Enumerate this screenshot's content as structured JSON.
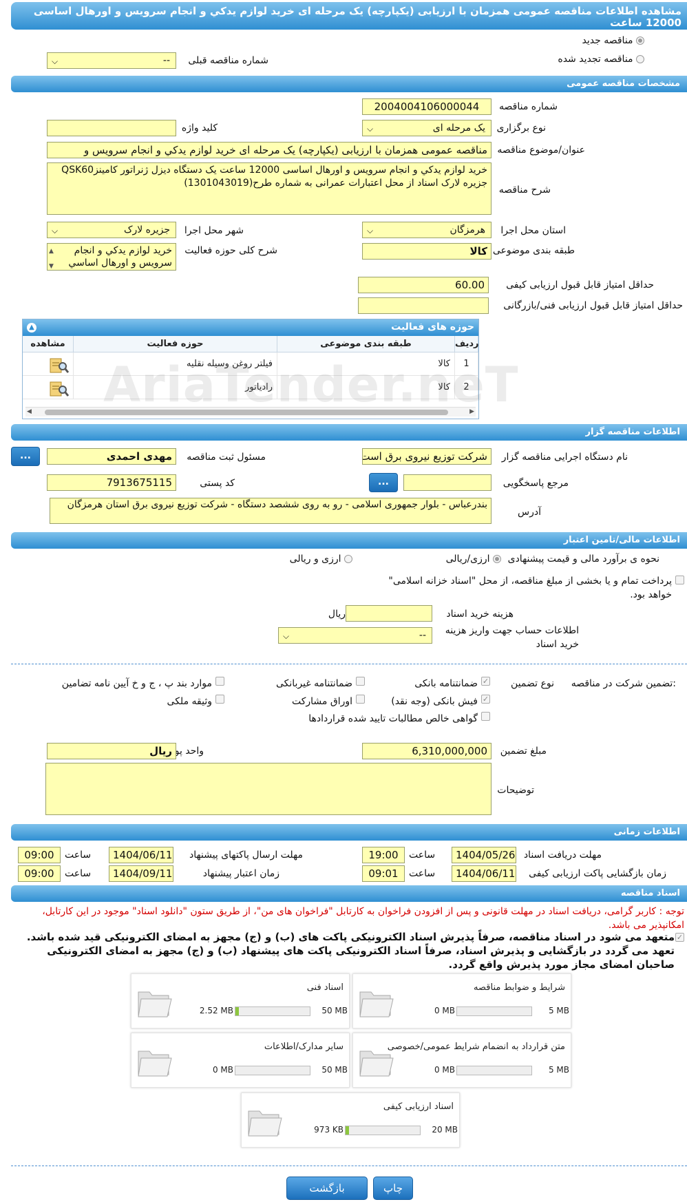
{
  "header": {
    "title": "مشاهده اطلاعات مناقصه عمومی همزمان با ارزیابی (یکپارچه) یک مرحله ای خرید لوازم یدکي و انجام سرویس و اورهال اساسی 12000 ساعت"
  },
  "top": {
    "new_label": "مناقصه جدید",
    "renewed_label": "مناقصه تجدید شده",
    "prev_no_label": "شماره مناقصه قبلی",
    "prev_no_value": "--"
  },
  "general": {
    "section_title": "مشخصات مناقصه عمومی",
    "tender_no_label": "شماره مناقصه",
    "tender_no": "2004004106000044",
    "type_label": "نوع برگزاری",
    "type_value": "یک مرحله ای",
    "keyword_label": "کلید واژه",
    "keyword_value": "",
    "subject_label": "عنوان/موضوع مناقصه",
    "subject_value": "مناقصه عمومی همزمان با ارزیابی (یکپارچه) یک مرحله ای خرید لوازم یدکي و انجام سرویس و",
    "desc_label": "شرح مناقصه",
    "desc_value": "خرید لوازم یدکي و انجام سرویس و اورهال اساسی 12000 ساعت یک دستگاه دیزل ژنراتور کامینزQSK60 جزیره لارک اسناد  از  محل اعتبارات عمرانی به شماره طرح(1301043019)",
    "province_label": "استان محل اجرا",
    "province_value": "هرمزگان",
    "city_label": "شهر محل اجرا",
    "city_value": "جزیره لارک",
    "category_label": "طبقه بندی موضوعی",
    "category_value": "کالا",
    "scope_label": "شرح کلی حوزه فعالیت",
    "scope_value": "خرید لوازم یدکي و انجام سرویس و اورهال اساسي",
    "min_quality_label": "حداقل امتیاز قابل قبول ارزیابی کیفی",
    "min_quality_value": "60.00",
    "min_tech_label": "حداقل امتیاز قابل قبول ارزیابی فنی/بازرگانی",
    "min_tech_value": ""
  },
  "activities": {
    "title": "حوزه های فعالیت",
    "columns": [
      "ردیف",
      "طبقه بندی موضوعی",
      "حوزه فعالیت",
      "مشاهده"
    ],
    "rows": [
      [
        "1",
        "کالا",
        "فیلتر روغن وسیله نقلیه"
      ],
      [
        "2",
        "کالا",
        "رادیاتور"
      ]
    ]
  },
  "watermark": "AriaTender.neT",
  "organizer": {
    "section_title": "اطلاعات مناقصه گزار",
    "org_label": "نام دستگاه اجرایی مناقصه گزار",
    "org_value": "شرکت توزیع نیروی برق است",
    "responsible_label": "مسئول ثبت مناقصه",
    "responsible_value": "مهدی احمدی",
    "ref_label": "مرجع پاسخگویی",
    "ref_value": "",
    "postal_label": "کد پستی",
    "postal_value": "7913675115",
    "address_label": "آدرس",
    "address_value": "بندرعباس - بلوار جمهوری اسلامی - رو به روی ششصد دستگاه - شرکت توزیع نیروی برق استان هرمزگان",
    "dots": "..."
  },
  "financial": {
    "section_title": "اطلاعات مالی/تامین اعتبار",
    "estimate_label": "نحوه ی برآورد مالی و قیمت پیشنهادی",
    "opt_rial": "ارزی/ریالی",
    "opt_fx": "ارزی و ریالی",
    "treasury_text": "پرداخت تمام و یا بخشی از مبلغ مناقصه، از محل \"اسناد خزانه اسلامی\" خواهد بود.",
    "doc_fee_label": "هزینه خرید اسناد",
    "doc_fee_value": "",
    "doc_fee_unit": "ریال",
    "account_label": "اطلاعات حساب جهت واریز هزینه خرید اسناد",
    "account_value": "--"
  },
  "guarantee": {
    "label": "تضمین شرکت در مناقصه:",
    "type_label": "نوع تضمین",
    "bank": "ضمانتنامه بانکی",
    "nonbank": "ضمانتنامه غیربانکی",
    "regulation": "موارد بند پ ، ج و خ آیین نامه تضامین",
    "check": "فیش بانکی (وجه نقد)",
    "bonds": "اوراق مشارکت",
    "property": "وثیقه ملکی",
    "claims": "گواهی خالص مطالبات تایید شده قراردادها",
    "amount_label": "مبلغ تضمین",
    "amount_value": "6,310,000,000",
    "currency_label": "واحد پول",
    "currency_value": "ریال",
    "notes_label": "توضیحات",
    "notes_value": ""
  },
  "timing": {
    "section_title": "اطلاعات زمانی",
    "receive_label": "مهلت دریافت اسناد",
    "receive_date": "1404/05/26",
    "receive_time": "19:00",
    "send_label": "مهلت ارسال پاکتهای پیشنهاد",
    "send_date": "1404/06/11",
    "send_time": "09:00",
    "open_label": "زمان بازگشایی پاکت ارزیابی کیفی",
    "open_date": "1404/06/11",
    "open_time": "09:01",
    "valid_label": "زمان اعتبار پیشنهاد",
    "valid_date": "1404/09/11",
    "valid_time": "09:00",
    "time_word": "ساعت"
  },
  "documents": {
    "section_title": "اسناد مناقصه",
    "notice": "توجه : کاربر گرامی، دریافت اسناد در مهلت قانونی و پس از افزودن فراخوان به کارتابل \"فراخوان های من\"، از طریق ستون \"دانلود اسناد\" موجود در این کارتابل، امکانپذیر می باشد.",
    "commit": "متعهد می شود در اسناد مناقصه، صرفاً پذیرش اسناد الکترونیکی پاکت های (ب) و (ج) مجهز به امضای الکترونیکی قید شده باشد. تعهد می گردد در بازگشایی و پذیرش اسناد، صرفاً اسناد الکترونیکی پاکت های پیشنهاد (ب) و (ج) مجهز به امضای الکترونیکی صاحبان امضای مجاز مورد پذیرش واقع گردد.",
    "tiles": [
      {
        "name": "شرایط و ضوابط مناقصه",
        "current": "0 MB",
        "max": "5 MB",
        "fill": 0
      },
      {
        "name": "اسناد فنی",
        "current": "2.52 MB",
        "max": "50 MB",
        "fill": 0.05
      },
      {
        "name": "متن قرارداد به انضمام شرایط عمومی/خصوصی",
        "current": "0 MB",
        "max": "5 MB",
        "fill": 0
      },
      {
        "name": "سایر مدارک/اطلاعات",
        "current": "0 MB",
        "max": "50 MB",
        "fill": 0
      },
      {
        "name": "اسناد ارزیابی کیفی",
        "current": "973 KB",
        "max": "20 MB",
        "fill": 0.05
      }
    ]
  },
  "buttons": {
    "print": "چاپ",
    "back": "بازگشت"
  },
  "colors": {
    "header": "#2f8fd2",
    "input_bg": "#ffffb3",
    "notice_red": "#d40000"
  }
}
